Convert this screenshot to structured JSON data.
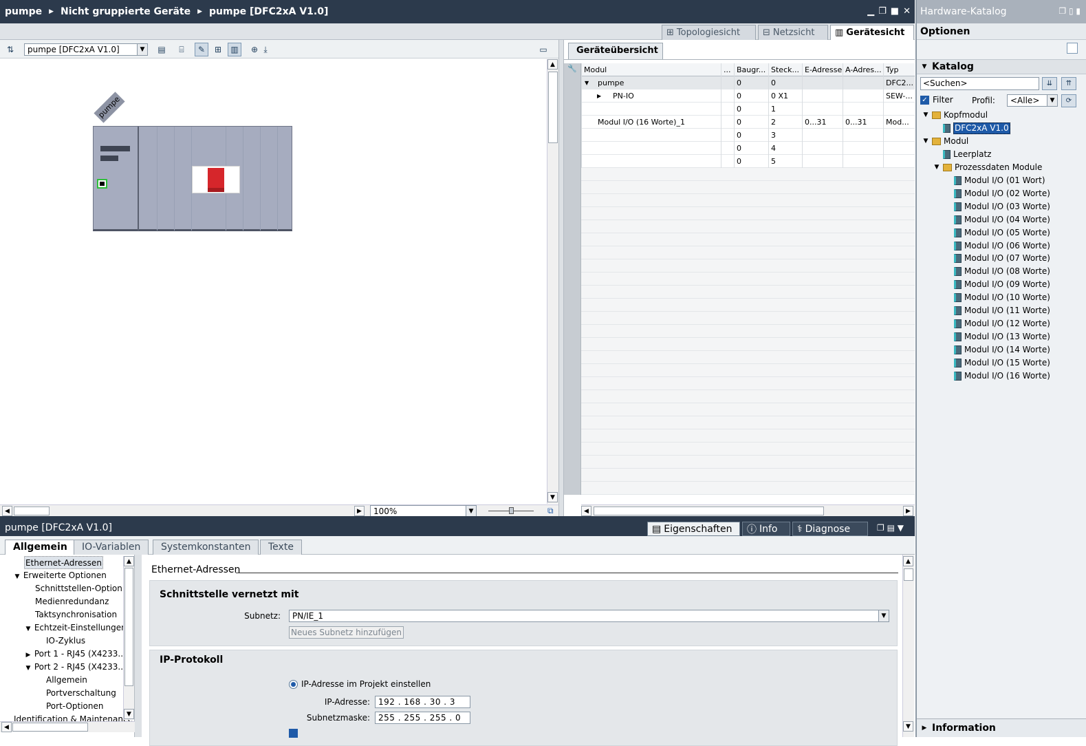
{
  "breadcrumb": {
    "item1": "pumpe",
    "item2": "Nicht gruppierte Geräte",
    "item3": "pumpe [DFC2xA V1.0]"
  },
  "view_tabs": {
    "topology": "Topologiesicht",
    "network": "Netzsicht",
    "device": "Gerätesicht"
  },
  "toolbar": {
    "device_select": "pumpe [DFC2xA V1.0]"
  },
  "canvas": {
    "device_label": "pumpe",
    "zoom": "100%"
  },
  "overview": {
    "tab": "Geräteübersicht",
    "columns": [
      "Modul",
      "...",
      "Baugr...",
      "Steck...",
      "E-Adresse",
      "A-Adres...",
      "Typ"
    ],
    "rows": [
      {
        "modul": "pumpe",
        "baugr": "0",
        "steck": "0",
        "e": "",
        "a": "",
        "typ": "DFC2...",
        "expand": "▼"
      },
      {
        "modul": "PN-IO",
        "baugr": "0",
        "steck": "0 X1",
        "e": "",
        "a": "",
        "typ": "SEW-...",
        "expand": "▶"
      },
      {
        "modul": "",
        "baugr": "0",
        "steck": "1",
        "e": "",
        "a": "",
        "typ": "",
        "expand": ""
      },
      {
        "modul": "Modul I/O (16 Worte)_1",
        "baugr": "0",
        "steck": "2",
        "e": "0...31",
        "a": "0...31",
        "typ": "Mod...",
        "expand": ""
      },
      {
        "modul": "",
        "baugr": "0",
        "steck": "3",
        "e": "",
        "a": "",
        "typ": "",
        "expand": ""
      },
      {
        "modul": "",
        "baugr": "0",
        "steck": "4",
        "e": "",
        "a": "",
        "typ": "",
        "expand": ""
      },
      {
        "modul": "",
        "baugr": "0",
        "steck": "5",
        "e": "",
        "a": "",
        "typ": "",
        "expand": ""
      }
    ]
  },
  "catalog": {
    "title": "Hardware-Katalog",
    "options": "Optionen",
    "section": "Katalog",
    "search_placeholder": "<Suchen>",
    "filter_label": "Filter",
    "profile_label": "Profil:",
    "profile_value": "<Alle>",
    "info": "Information",
    "tree": {
      "kopfmodul": "Kopfmodul",
      "dfc": "DFC2xA V1.0",
      "modul": "Modul",
      "leerplatz": "Leerplatz",
      "prozess": "Prozessdaten Module",
      "items": [
        "Modul I/O (01 Wort)",
        "Modul I/O (02 Worte)",
        "Modul I/O (03 Worte)",
        "Modul I/O (04 Worte)",
        "Modul I/O (05 Worte)",
        "Modul I/O (06 Worte)",
        "Modul I/O (07 Worte)",
        "Modul I/O (08 Worte)",
        "Modul I/O (09 Worte)",
        "Modul I/O (10 Worte)",
        "Modul I/O (11 Worte)",
        "Modul I/O (12 Worte)",
        "Modul I/O (13 Worte)",
        "Modul I/O (14 Worte)",
        "Modul I/O (15 Worte)",
        "Modul I/O (16 Worte)"
      ]
    }
  },
  "properties": {
    "title": "pumpe [DFC2xA V1.0]",
    "tabs": {
      "eigenschaften": "Eigenschaften",
      "info": "Info",
      "diagnose": "Diagnose"
    },
    "subtabs": [
      "Allgemein",
      "IO-Variablen",
      "Systemkonstanten",
      "Texte"
    ],
    "nav": [
      "Ethernet-Adressen",
      "Erweiterte Optionen",
      "Schnittstellen-Option...",
      "Medienredundanz",
      "Taktsynchronisation",
      "Echtzeit-Einstellungen",
      "IO-Zyklus",
      "Port 1 - RJ45 (X4233...",
      "Port 2 - RJ45 (X4233...",
      "Allgemein",
      "Portverschaltung",
      "Port-Optionen",
      "Identification & Maintenance"
    ],
    "body": {
      "heading": "Ethernet-Adressen",
      "sec1": "Schnittstelle vernetzt mit",
      "subnet_label": "Subnetz:",
      "subnet_value": "PN/IE_1",
      "add_subnet": "Neues Subnetz hinzufügen",
      "sec2": "IP-Protokoll",
      "ip_radio": "IP-Adresse im Projekt einstellen",
      "ip_label": "IP-Adresse:",
      "ip_value": "192 . 168 . 30   . 3",
      "mask_label": "Subnetzmaske:",
      "mask_value": "255 . 255 . 255 . 0"
    }
  }
}
